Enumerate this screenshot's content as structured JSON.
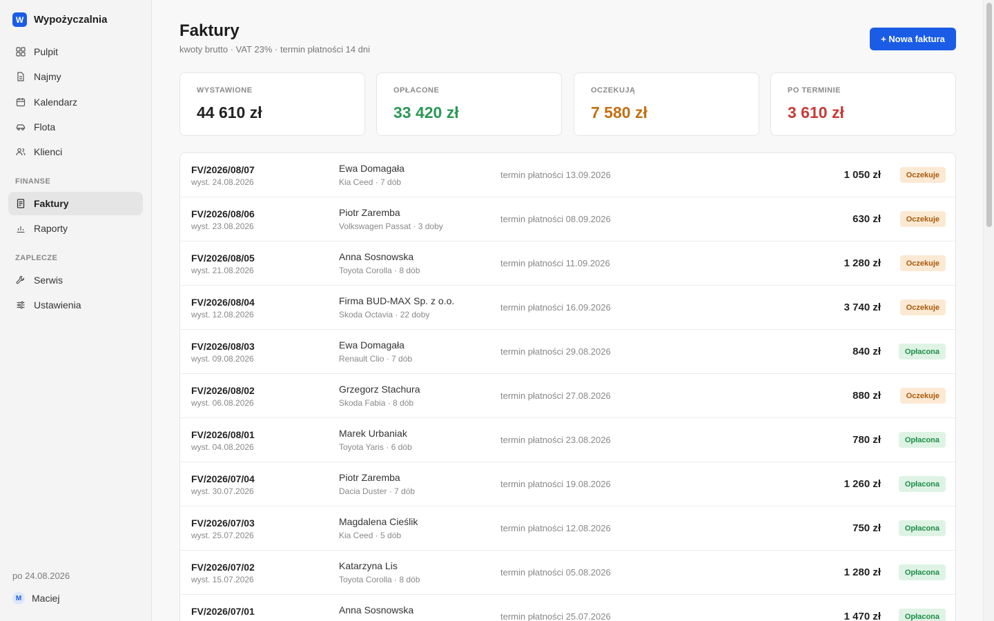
{
  "sidebar": {
    "brand": {
      "logo": "W",
      "name": "Wypożyczalnia"
    },
    "nav_main": [
      {
        "label": "Pulpit",
        "icon": "grid-icon"
      },
      {
        "label": "Najmy",
        "icon": "document-icon"
      },
      {
        "label": "Kalendarz",
        "icon": "calendar-icon"
      },
      {
        "label": "Flota",
        "icon": "car-icon"
      },
      {
        "label": "Klienci",
        "icon": "users-icon"
      }
    ],
    "section_finance": "FINANSE",
    "nav_finance": [
      {
        "label": "Faktury",
        "icon": "invoice-icon",
        "active": true
      },
      {
        "label": "Raporty",
        "icon": "bar-chart-icon"
      }
    ],
    "section_backoffice": "ZAPLECZE",
    "nav_backoffice": [
      {
        "label": "Serwis",
        "icon": "wrench-icon"
      },
      {
        "label": "Ustawienia",
        "icon": "sliders-icon"
      }
    ],
    "date": "po 24.08.2026",
    "user": {
      "initial": "M",
      "name": "Maciej"
    }
  },
  "header": {
    "title": "Faktury",
    "subtitle": "kwoty brutto · VAT 23% · termin płatności 14 dni",
    "new_button": "+ Nowa faktura"
  },
  "stats": [
    {
      "label": "WYSTAWIONE",
      "value": "44 610 zł",
      "color": "#222222"
    },
    {
      "label": "OPŁACONE",
      "value": "33 420 zł",
      "color": "#2b9955"
    },
    {
      "label": "OCZEKUJĄ",
      "value": "7 580 zł",
      "color": "#c46f12"
    },
    {
      "label": "PO TERMINIE",
      "value": "3 610 zł",
      "color": "#c83a36"
    }
  ],
  "invoices": [
    {
      "number": "FV/2026/08/07",
      "issued": "wyst. 24.08.2026",
      "client": "Ewa Domagała",
      "car": "Kia Ceed · 7 dób",
      "due": "termin płatności 13.09.2026",
      "amount": "1 050 zł",
      "status": "Oczekuje",
      "status_type": "pending"
    },
    {
      "number": "FV/2026/08/06",
      "issued": "wyst. 23.08.2026",
      "client": "Piotr Zaremba",
      "car": "Volkswagen Passat · 3 doby",
      "due": "termin płatności 08.09.2026",
      "amount": "630 zł",
      "status": "Oczekuje",
      "status_type": "pending"
    },
    {
      "number": "FV/2026/08/05",
      "issued": "wyst. 21.08.2026",
      "client": "Anna Sosnowska",
      "car": "Toyota Corolla · 8 dób",
      "due": "termin płatności 11.09.2026",
      "amount": "1 280 zł",
      "status": "Oczekuje",
      "status_type": "pending"
    },
    {
      "number": "FV/2026/08/04",
      "issued": "wyst. 12.08.2026",
      "client": "Firma BUD-MAX Sp. z o.o.",
      "car": "Skoda Octavia · 22 doby",
      "due": "termin płatności 16.09.2026",
      "amount": "3 740 zł",
      "status": "Oczekuje",
      "status_type": "pending"
    },
    {
      "number": "FV/2026/08/03",
      "issued": "wyst. 09.08.2026",
      "client": "Ewa Domagała",
      "car": "Renault Clio · 7 dób",
      "due": "termin płatności 29.08.2026",
      "amount": "840 zł",
      "status": "Opłacona",
      "status_type": "paid"
    },
    {
      "number": "FV/2026/08/02",
      "issued": "wyst. 06.08.2026",
      "client": "Grzegorz Stachura",
      "car": "Skoda Fabia · 8 dób",
      "due": "termin płatności 27.08.2026",
      "amount": "880 zł",
      "status": "Oczekuje",
      "status_type": "pending"
    },
    {
      "number": "FV/2026/08/01",
      "issued": "wyst. 04.08.2026",
      "client": "Marek Urbaniak",
      "car": "Toyota Yaris · 6 dób",
      "due": "termin płatności 23.08.2026",
      "amount": "780 zł",
      "status": "Opłacona",
      "status_type": "paid"
    },
    {
      "number": "FV/2026/07/04",
      "issued": "wyst. 30.07.2026",
      "client": "Piotr Zaremba",
      "car": "Dacia Duster · 7 dób",
      "due": "termin płatności 19.08.2026",
      "amount": "1 260 zł",
      "status": "Opłacona",
      "status_type": "paid"
    },
    {
      "number": "FV/2026/07/03",
      "issued": "wyst. 25.07.2026",
      "client": "Magdalena Cieślik",
      "car": "Kia Ceed · 5 dób",
      "due": "termin płatności 12.08.2026",
      "amount": "750 zł",
      "status": "Opłacona",
      "status_type": "paid"
    },
    {
      "number": "FV/2026/07/02",
      "issued": "wyst. 15.07.2026",
      "client": "Katarzyna Lis",
      "car": "Toyota Corolla · 8 dób",
      "due": "termin płatności 05.08.2026",
      "amount": "1 280 zł",
      "status": "Opłacona",
      "status_type": "paid"
    },
    {
      "number": "FV/2026/07/01",
      "issued": "",
      "client": "Anna Sosnowska",
      "car": "",
      "due": "termin płatności 25.07.2026",
      "amount": "1 470 zł",
      "status": "Opłacona",
      "status_type": "paid"
    }
  ]
}
